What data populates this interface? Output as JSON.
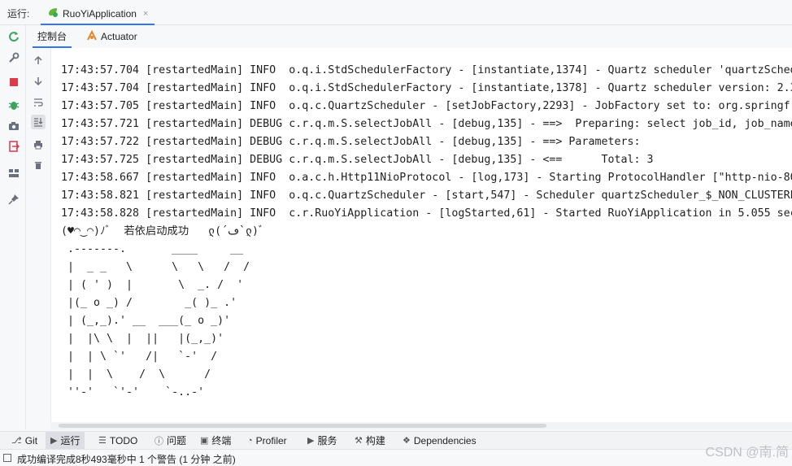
{
  "runbar": {
    "label": "运行:",
    "tab_name": "RuoYiApplication",
    "close_glyph": "×"
  },
  "subtabs": [
    {
      "label": "控制台"
    },
    {
      "label": "Actuator"
    }
  ],
  "console": {
    "lines": [
      "17:43:57.704 [restartedMain] INFO  o.q.i.StdSchedulerFactory - [instantiate,1374] - Quartz scheduler 'quartzSched",
      "17:43:57.704 [restartedMain] INFO  o.q.i.StdSchedulerFactory - [instantiate,1378] - Quartz scheduler version: 2.3",
      "17:43:57.705 [restartedMain] INFO  o.q.c.QuartzScheduler - [setJobFactory,2293] - JobFactory set to: org.springfr",
      "17:43:57.721 [restartedMain] DEBUG c.r.q.m.S.selectJobAll - [debug,135] - ==>  Preparing: select job_id, job_name",
      "17:43:57.722 [restartedMain] DEBUG c.r.q.m.S.selectJobAll - [debug,135] - ==> Parameters: ",
      "17:43:57.725 [restartedMain] DEBUG c.r.q.m.S.selectJobAll - [debug,135] - <==      Total: 3",
      "17:43:58.667 [restartedMain] INFO  o.a.c.h.Http11NioProtocol - [log,173] - Starting ProtocolHandler [\"http-nio-80",
      "17:43:58.821 [restartedMain] INFO  o.q.c.QuartzScheduler - [start,547] - Scheduler quartzScheduler_$_NON_CLUSTERE",
      "17:43:58.828 [restartedMain] INFO  c.r.RuoYiApplication - [logStarted,61] - Started RuoYiApplication in 5.055 sec",
      "(♥◠‿◠)ﾉﾞ  若依启动成功   ლ(´ڡ`ლ)ﾞ",
      " .-------.       ____     __",
      " |  _ _   \\      \\   \\   /  /",
      " | ( ' )  |       \\  _. /  '",
      " |(_ o _) /        _( )_ .'",
      " | (_,_).' __  ___(_ o _)'",
      " |  |\\ \\  |  ||   |(_,_)'",
      " |  | \\ `'   /|   `-'  /",
      " |  |  \\    /  \\      /",
      " ''-'   `'-'    `-..-'"
    ]
  },
  "bottom_tabs": [
    {
      "label": "Git",
      "icon": "git-branch-icon"
    },
    {
      "label": "运行",
      "icon": "run-icon"
    },
    {
      "label": "TODO",
      "icon": "list-icon"
    },
    {
      "label": "问题",
      "icon": "problems-icon"
    },
    {
      "label": "终端",
      "icon": "terminal-icon"
    },
    {
      "label": "Profiler",
      "icon": "profiler-icon"
    },
    {
      "label": "服务",
      "icon": "services-icon"
    },
    {
      "label": "构建",
      "icon": "hammer-icon"
    },
    {
      "label": "Dependencies",
      "icon": "dependencies-icon"
    }
  ],
  "status": {
    "message": "成功编译完成8秒493毫秒中 1 个警告 (1 分钟 之前)"
  },
  "watermark": "CSDN @南.简",
  "colors": {
    "accent": "#3574f0",
    "console_bg": "#ffffff",
    "run_green": "#3ba55c"
  }
}
